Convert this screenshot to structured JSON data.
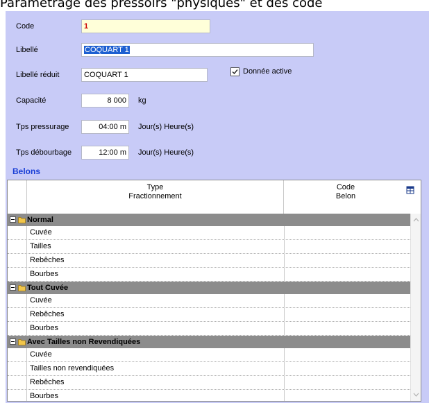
{
  "heading": "Paramétrage des pressoirs \"physiques\" et des code",
  "form": {
    "code_label": "Code",
    "code_value": "1",
    "libelle_label": "Libellé",
    "libelle_value": "COQUART 1",
    "libelle_reduit_label": "Libellé réduit",
    "libelle_reduit_value": "COQUART 1",
    "donnee_active_label": "Donnée active",
    "donnee_active_checked": true,
    "capacite_label": "Capacité",
    "capacite_value": "8 000",
    "capacite_unit": "kg",
    "tps_pressurage_label": "Tps pressurage",
    "tps_pressurage_value": "04:00 m",
    "tps_pressurage_unit": "Jour(s) Heure(s)",
    "tps_debourbage_label": "Tps débourbage",
    "tps_debourbage_value": "12:00 m",
    "tps_debourbage_unit": "Jour(s) Heure(s)"
  },
  "belons": {
    "title": "Belons",
    "columns": [
      {
        "line1": "Type",
        "line2": "Fractionnement"
      },
      {
        "line1": "Code",
        "line2": "Belon"
      }
    ],
    "groups": [
      {
        "name": "Normal",
        "rows": [
          "Cuvée",
          "Tailles",
          "Rebêches",
          "Bourbes"
        ]
      },
      {
        "name": "Tout Cuvée",
        "rows": [
          "Cuvée",
          "Rebêches",
          "Bourbes"
        ]
      },
      {
        "name": "Avec Tailles non Revendiquées",
        "rows": [
          "Cuvée",
          "Tailles non revendiquées",
          "Rebêches",
          "Bourbes"
        ]
      }
    ]
  },
  "colors": {
    "panel_bg": "#c8cbf7",
    "section_title": "#1a3fd6",
    "group_row_bg": "#8c8c8c",
    "code_field_bg": "#ffffd9",
    "code_value_text": "#cc0000",
    "selection": "#1d5fd1"
  },
  "icons": {
    "checkbox": "checkmark-icon",
    "group_toggle": "collapse-minus-icon",
    "group_folder": "folder-icon",
    "table_options": "table-options-icon",
    "scroll_up": "chevron-up-icon",
    "scroll_down": "chevron-down-icon"
  }
}
